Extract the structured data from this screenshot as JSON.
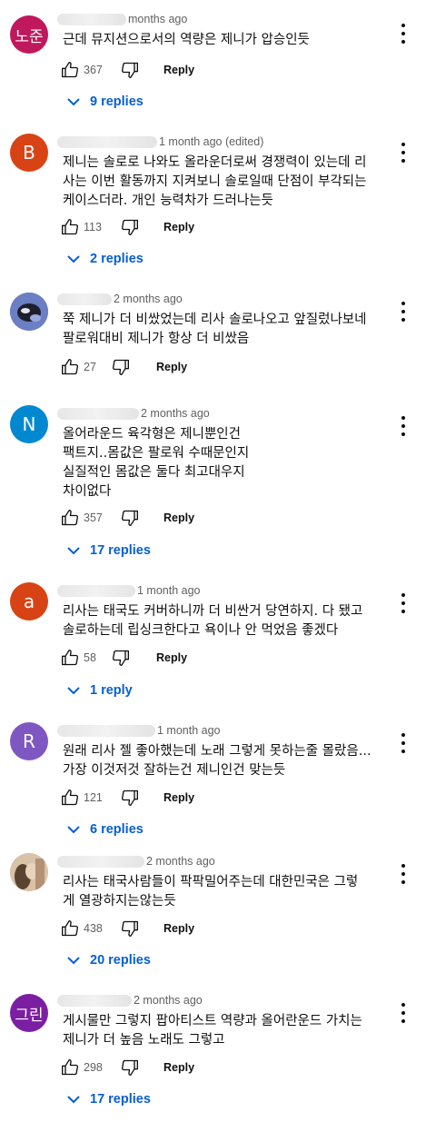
{
  "ui": {
    "reply_label": "Reply",
    "icons": {
      "like": "thumb-up-outline",
      "dislike": "thumb-down-outline",
      "menu": "vertical-ellipsis",
      "expand": "chevron-down"
    },
    "colors": {
      "link_blue": "#065fd4",
      "meta_gray": "#606060"
    }
  },
  "comments": [
    {
      "avatar_text": "노준",
      "avatar_color": "#c0185c",
      "time": "months ago",
      "text": "근데 뮤지션으로서의 역량은 제니가 압승인듯",
      "likes": "367",
      "replies": "9 replies"
    },
    {
      "avatar_text": "B",
      "avatar_color": "#d84315",
      "time": "1 month ago (edited)",
      "text": "제니는 솔로로 나와도 올라운더로써  경쟁력이 있는데 리\n사는 이번 활동까지 지켜보니 솔로일때 단점이 부각되는\n케이스더라. 개인 능력차가 드러나는듯",
      "likes": "113",
      "replies": "2 replies"
    },
    {
      "avatar_text": "",
      "avatar_color": "#5a6fb4",
      "time": "2 months ago",
      "text": "쭉 제니가 더 비쌌었는데 리사 솔로나오고 앞질렀나보네\n팔로워대비 제니가 항상 더 비쌌음",
      "likes": "27",
      "replies": ""
    },
    {
      "avatar_text": "N",
      "avatar_color": "#0288d1",
      "time": "2 months ago",
      "text": "올어라운드 육각형은 제니뿐인건\n팩트지..몸값은 팔로워 수때문인지\n실질적인 몸값은 둘다 최고대우지\n차이없다",
      "likes": "357",
      "replies": "17 replies"
    },
    {
      "avatar_text": "a",
      "avatar_color": "#d84315",
      "time": "1 month ago",
      "text": "리사는 태국도 커버하니까 더 비싼거 당연하지. 다 됐고\n솔로하는데 립싱크한다고 욕이나 안 먹었음 좋겠다",
      "likes": "58",
      "replies": "1 reply"
    },
    {
      "avatar_text": "R",
      "avatar_color": "#7e57c2",
      "time": "1 month ago",
      "text": "원래 리사 젤 좋아했는데 노래 그렇게 못하는줄 몰랐음...\n가장 이것저것 잘하는건 제니인건 맞는듯",
      "likes": "121",
      "replies": "6 replies"
    },
    {
      "avatar_text": "",
      "avatar_color": "#b89a7a",
      "time": "2 months ago",
      "text": "리사는 태국사람들이 팍팍밀어주는데 대한민국은 그렇\n게 열광하지는않는듯",
      "likes": "438",
      "replies": "20 replies"
    },
    {
      "avatar_text": "그린",
      "avatar_color": "#7b1fa2",
      "time": "2 months ago",
      "text": "게시물만 그렇지 팝아티스트 역량과 올어란운드 가치는\n제니가 더 높음 노래도 그렇고",
      "likes": "298",
      "replies": "17 replies"
    }
  ]
}
